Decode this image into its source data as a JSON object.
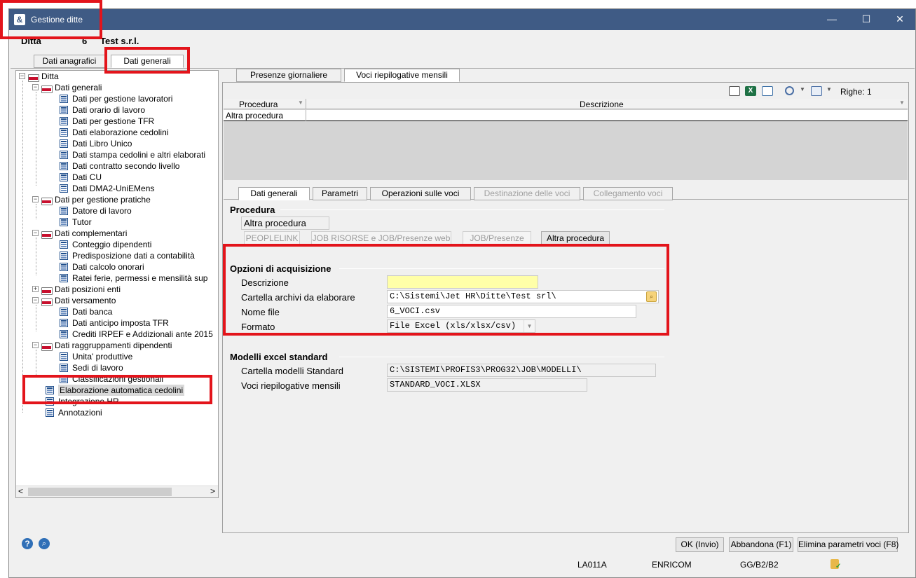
{
  "window": {
    "title": "Gestione ditte",
    "icon": "company-app-icon",
    "controls": {
      "minimize": "—",
      "maximize": "☐",
      "close": "✕"
    }
  },
  "header": {
    "ditta_label": "Ditta",
    "ditta_code": "6",
    "ditta_name": "Test s.r.l."
  },
  "top_tabs": [
    "Dati anagrafici",
    "Dati generali"
  ],
  "tree": {
    "root": "Ditta",
    "items": [
      "Dati generali",
      "Dati per gestione lavoratori",
      "Dati orario di lavoro",
      "Dati per gestione TFR",
      "Dati elaborazione cedolini",
      "Dati Libro Unico",
      "Dati stampa cedolini e altri elaborati",
      "Dati contratto secondo livello",
      "Dati CU",
      "Dati DMA2-UniEMens",
      "Dati per gestione pratiche",
      "Datore di lavoro",
      "Tutor",
      "Dati complementari",
      "Conteggio dipendenti",
      "Predisposizione dati a contabilità",
      "Dati calcolo onorari",
      "Ratei ferie, permessi e mensilità sup",
      "Dati posizioni enti",
      "Dati versamento",
      "Dati banca",
      "Dati anticipo imposta TFR",
      "Crediti IRPEF e Addizionali ante 2015",
      "Dati raggruppamenti dipendenti",
      "Unita' produttive",
      "Sedi di lavoro",
      "Classificazioni gestionali",
      "Elaborazione automatica cedolini",
      "Integrazione HR",
      "Annotazioni"
    ],
    "selected": "Elaborazione automatica cedolini",
    "scroll": {
      "left": "<",
      "right": ">"
    }
  },
  "inner_tabs": [
    "Presenze giornaliere",
    "Voci riepilogative mensili"
  ],
  "grid": {
    "rows_label": "Righe: 1",
    "columns": [
      "Procedura",
      "Descrizione"
    ],
    "rows": [
      [
        "Altra procedura",
        ""
      ]
    ]
  },
  "detail_tabs": [
    "Dati generali",
    "Parametri",
    "Operazioni sulle voci",
    "Destinazione delle voci",
    "Collegamento voci"
  ],
  "procedura": {
    "title": "Procedura",
    "value": "Altra procedura",
    "buttons": [
      "PEOPLELINK",
      "JOB RISORSE e JOB/Presenze web",
      "JOB/Presenze",
      "Altra procedura"
    ]
  },
  "opzioni": {
    "title": "Opzioni di acquisizione",
    "descrizione_label": "Descrizione",
    "descrizione_value": "",
    "cartella_label": "Cartella archivi da elaborare",
    "cartella_value": "C:\\Sistemi\\Jet HR\\Ditte\\Test srl\\",
    "nome_file_label": "Nome file",
    "nome_file_value": "6_VOCI.csv",
    "formato_label": "Formato",
    "formato_value": "File Excel (xls/xlsx/csv)"
  },
  "modelli": {
    "title": "Modelli excel standard",
    "cartella_label": "Cartella modelli Standard",
    "cartella_value": "C:\\SISTEMI\\PROFIS3\\PROG32\\JOB\\MODELLI\\",
    "voci_label": "Voci riepilogative mensili",
    "voci_value": "STANDARD_VOCI.XLSX"
  },
  "footer": {
    "ok": "OK (Invio)",
    "abbandona": "Abbandona (F1)",
    "elimina": "Elimina parametri voci (F8)"
  },
  "status": {
    "code": "LA011A",
    "user": "ENRICOM",
    "db": "GG/B2/B2"
  },
  "colors": {
    "titlebar": "#3f5b85",
    "highlight": "#e3141b",
    "selection": "#d9d9d9"
  }
}
